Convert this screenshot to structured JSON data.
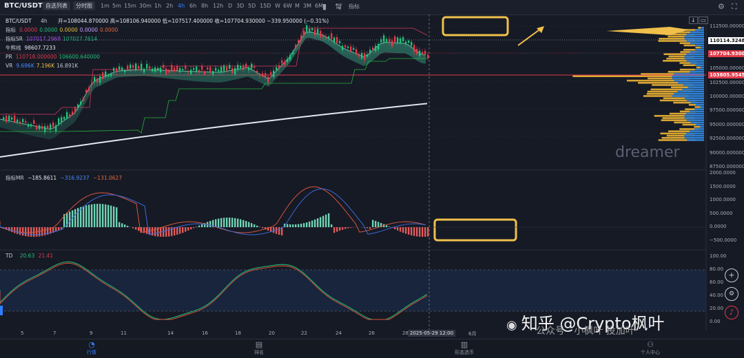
{
  "toolbar": {
    "symbol": "BTC/USDT",
    "tabs": [
      "自选列表",
      "分时图"
    ],
    "intervals": [
      "1m",
      "5m",
      "15m",
      "30m",
      "1h",
      "2h",
      "4h",
      "6h",
      "8h",
      "12h",
      "D",
      "3D",
      "5D",
      "15D",
      "W",
      "6W",
      "M",
      "3M",
      "6M"
    ],
    "active_interval": "4h",
    "indicator_label": "指标",
    "icons": [
      "candle-icon",
      "compare-icon",
      "drawing-icon"
    ]
  },
  "legend": {
    "symbol": "BTC/USDT",
    "interval": "4h",
    "ohlc": "开=108044.870000  高=108106.940000  低=107517.400000  收=107704.930000  −339.950000 (−0.31%)",
    "rows": [
      {
        "label": "指标",
        "values": [
          "0.0000",
          "0.0000",
          "0.0000",
          "0.0000",
          "0.0000"
        ],
        "colors": [
          "#e23b4a",
          "#21c27a",
          "#e3c23b",
          "#c8a2ff",
          "#e36a3b"
        ]
      },
      {
        "label": "指标SR",
        "values": [
          "107017.2968",
          "107027.7614"
        ],
        "colors": [
          "#a24fe0",
          "#27b27c"
        ]
      },
      {
        "label": "牛熊线",
        "values": [
          "98607.7233"
        ],
        "colors": [
          "#e6e8ee"
        ]
      },
      {
        "label": "PR",
        "values": [
          "110718.000000",
          "106600.640000"
        ],
        "colors": [
          "#e23b4a",
          "#21c27a"
        ]
      },
      {
        "label": "VR",
        "values": [
          "9.696K",
          "7.196K",
          "16.891K"
        ],
        "colors": [
          "#4a8bff",
          "#f0c04b",
          "#c2c5cc"
        ]
      }
    ]
  },
  "price_axis": {
    "ticks": [
      "112500.000000",
      "110000.000000",
      "107500.000000",
      "105000.000000",
      "102500.000000",
      "100000.000000",
      "97500.000000",
      "95000.000000",
      "92500.000000",
      "90000.000000",
      "87500.000000"
    ],
    "tags": [
      {
        "text": "110114.324858",
        "bg": "#ffffff",
        "fg": "#111111"
      },
      {
        "text": "107704.930000",
        "bg": "#e23b4a",
        "fg": "#ffffff"
      },
      {
        "text": "103805.954545",
        "bg": "#e23b4a",
        "fg": "#ffffff"
      }
    ]
  },
  "watermark": "dreamer",
  "macd": {
    "label": "指标MR",
    "values": [
      "−185.8611",
      "−316.9237",
      "−131.0627"
    ],
    "colors": [
      "#e6e8ee",
      "#4a8bff",
      "#e36a3b"
    ],
    "ticks": [
      "2000.0000",
      "1500.0000",
      "1000.0000",
      "500.0000",
      "0.0000",
      "−500.0000"
    ]
  },
  "td": {
    "label": "TD",
    "values": [
      "20.63",
      "21.41"
    ],
    "colors": [
      "#21c27a",
      "#e23b4a"
    ],
    "ticks": [
      "100.00",
      "80.00",
      "60.00",
      "40.00",
      "20.00",
      "0.00"
    ]
  },
  "x_axis": {
    "labels": [
      "5",
      "7",
      "9",
      "11",
      "14",
      "16",
      "18",
      "20",
      "22",
      "24",
      "26",
      "28",
      "6月"
    ],
    "cursor_label": "2025-05-29   12:00"
  },
  "bottom_nav": {
    "items": [
      {
        "label": "行情",
        "icon": "chart-pie-icon",
        "active": true
      },
      {
        "label": "排名",
        "icon": "document-icon",
        "active": false
      },
      {
        "label": "形态选币",
        "icon": "filter-doc-icon",
        "active": false
      },
      {
        "label": "个人中心",
        "icon": "user-icon",
        "active": false
      }
    ]
  },
  "overlay_watermark": "知乎 @Crypto枫叶",
  "overlay_sub": "公众号 · 小枫叶 投加叶"
}
